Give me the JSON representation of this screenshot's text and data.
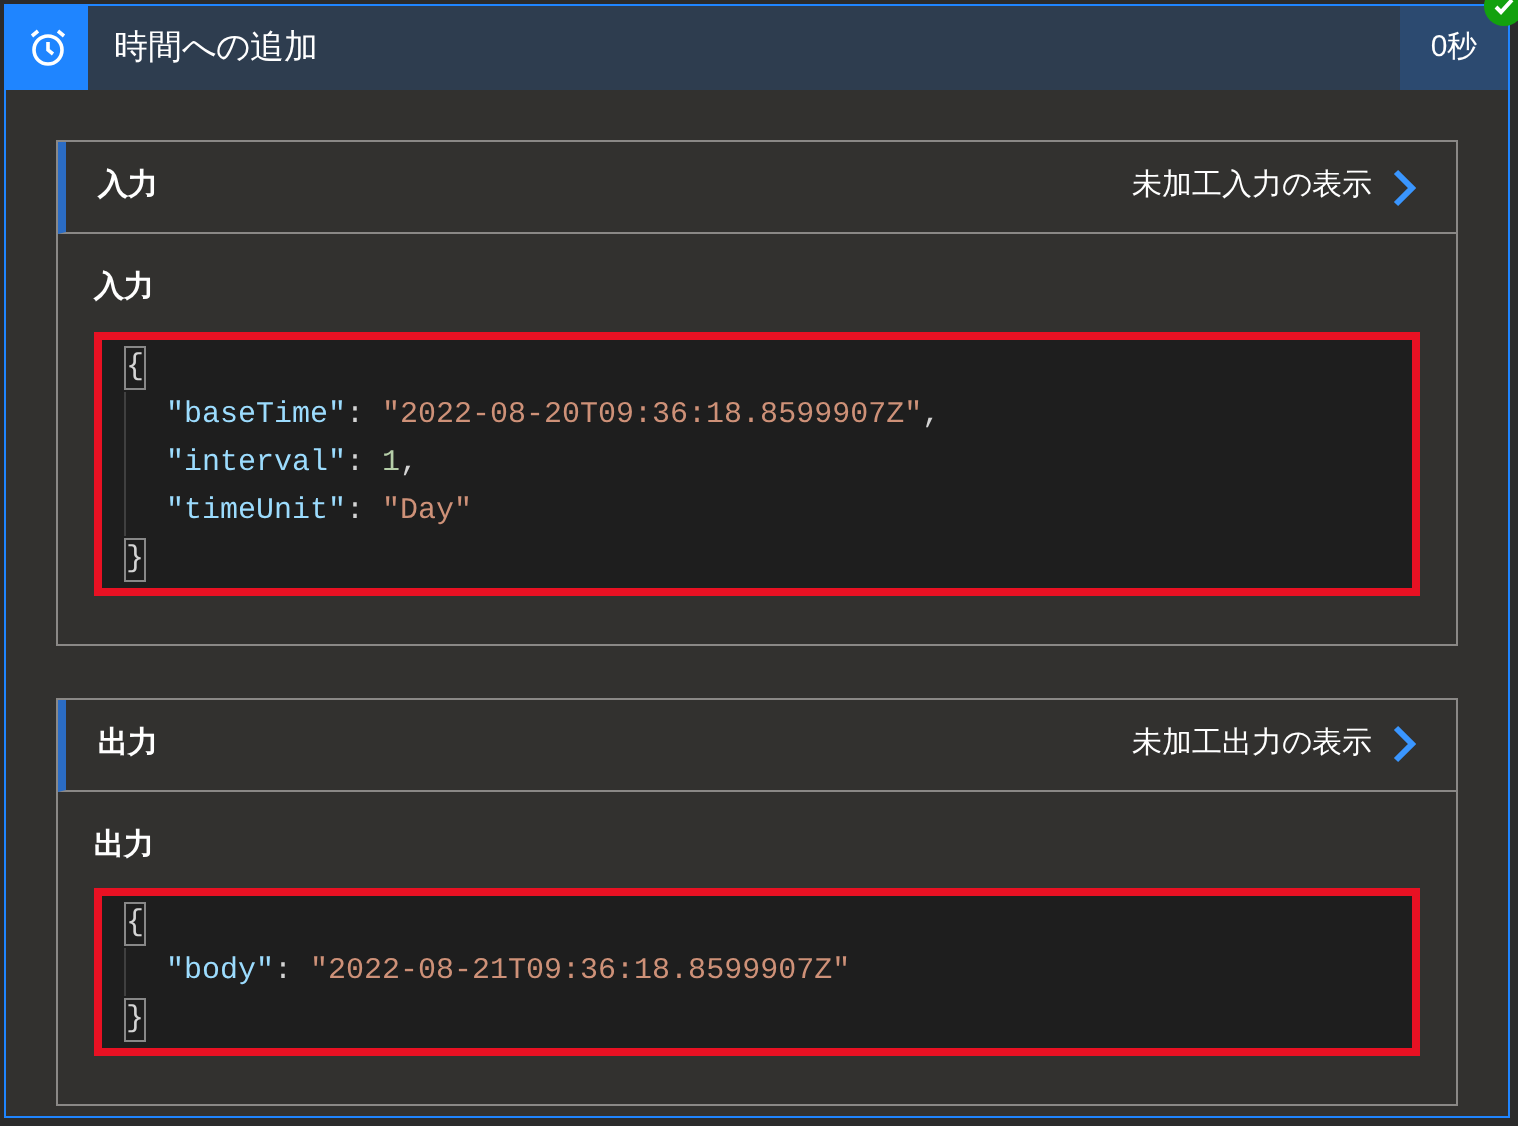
{
  "action": {
    "title": "時間への追加",
    "duration": "0秒",
    "succeeded": true
  },
  "sections": [
    {
      "header": "入力",
      "link": "未加工入力の表示",
      "label": "入力",
      "highlighted": true,
      "code_lines": [
        [
          {
            "kind": "brace",
            "text": "{"
          }
        ],
        [
          {
            "kind": "key",
            "text": "\"baseTime\""
          },
          {
            "kind": "punct",
            "text": ": "
          },
          {
            "kind": "string",
            "text": "\"2022-08-20T09:36:18.8599907Z\""
          },
          {
            "kind": "punct",
            "text": ","
          }
        ],
        [
          {
            "kind": "key",
            "text": "\"interval\""
          },
          {
            "kind": "punct",
            "text": ": "
          },
          {
            "kind": "number",
            "text": "1"
          },
          {
            "kind": "punct",
            "text": ","
          }
        ],
        [
          {
            "kind": "key",
            "text": "\"timeUnit\""
          },
          {
            "kind": "punct",
            "text": ": "
          },
          {
            "kind": "string",
            "text": "\"Day\""
          }
        ],
        [
          {
            "kind": "brace",
            "text": "}"
          }
        ]
      ]
    },
    {
      "header": "出力",
      "link": "未加工出力の表示",
      "label": "出力",
      "highlighted": true,
      "code_lines": [
        [
          {
            "kind": "brace",
            "text": "{"
          }
        ],
        [
          {
            "kind": "key",
            "text": "\"body\""
          },
          {
            "kind": "punct",
            "text": ": "
          },
          {
            "kind": "string",
            "text": "\"2022-08-21T09:36:18.8599907Z\""
          }
        ],
        [
          {
            "kind": "brace",
            "text": "}"
          }
        ]
      ]
    }
  ]
}
